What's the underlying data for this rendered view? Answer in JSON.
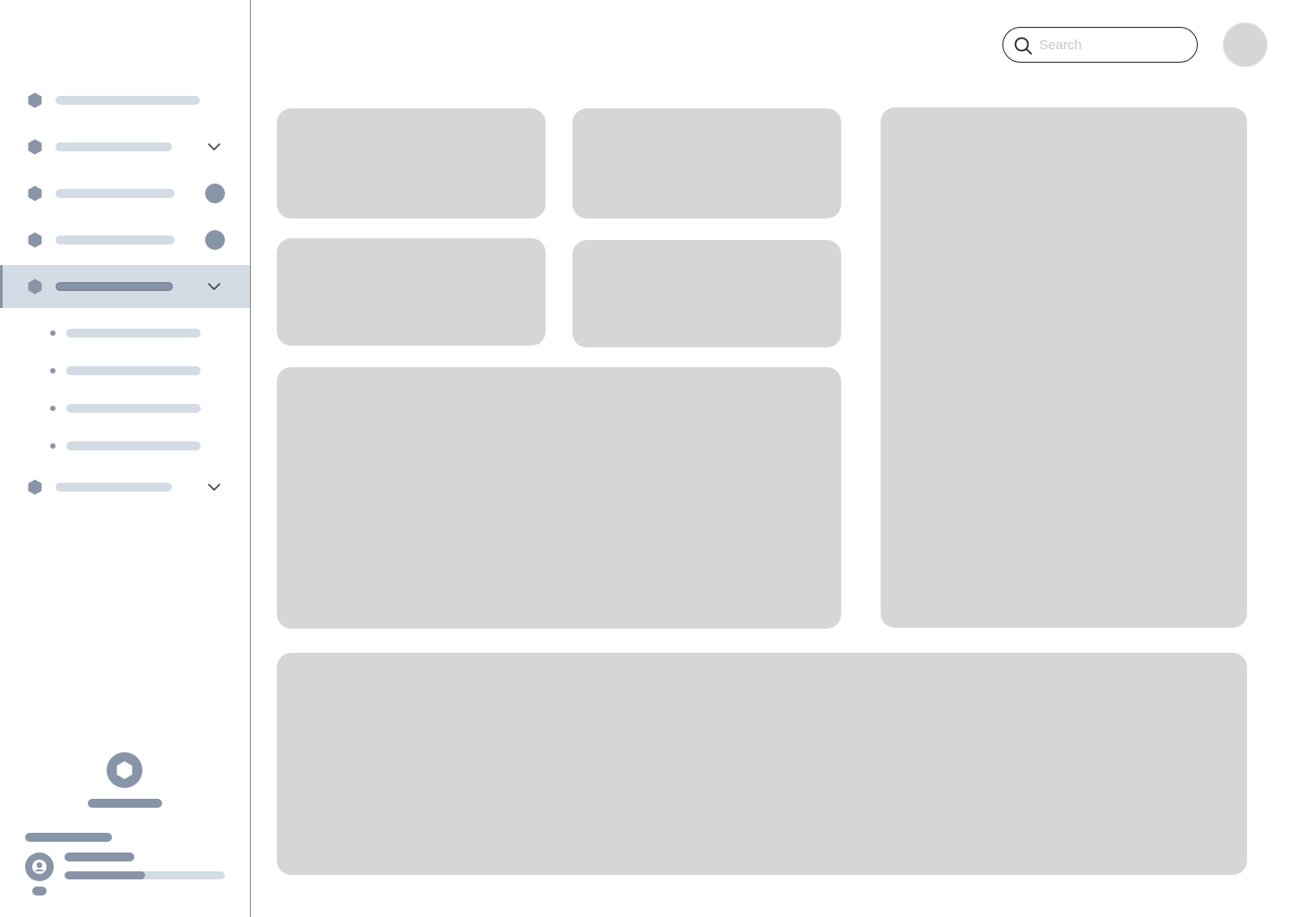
{
  "search": {
    "placeholder": "Search",
    "value": ""
  },
  "sidebar": {
    "items": [
      {
        "icon": "hexagon-icon",
        "trailing": "none"
      },
      {
        "icon": "hexagon-icon",
        "trailing": "chevron-down-icon"
      },
      {
        "icon": "hexagon-icon",
        "trailing": "badge"
      },
      {
        "icon": "hexagon-icon",
        "trailing": "badge"
      },
      {
        "icon": "hexagon-icon",
        "trailing": "chevron-down-icon",
        "active": true,
        "subitems": 4
      },
      {
        "icon": "hexagon-icon",
        "trailing": "chevron-down-icon"
      }
    ],
    "footer": {
      "logo_icon": "hexagon-icon",
      "avatar_icon": "user-icon",
      "progress": 0.5
    }
  },
  "colors": {
    "accent": "#8894a7",
    "skeleton_light": "#d3dbe4",
    "card": "#d6d6d6",
    "border": "#7f8794"
  }
}
